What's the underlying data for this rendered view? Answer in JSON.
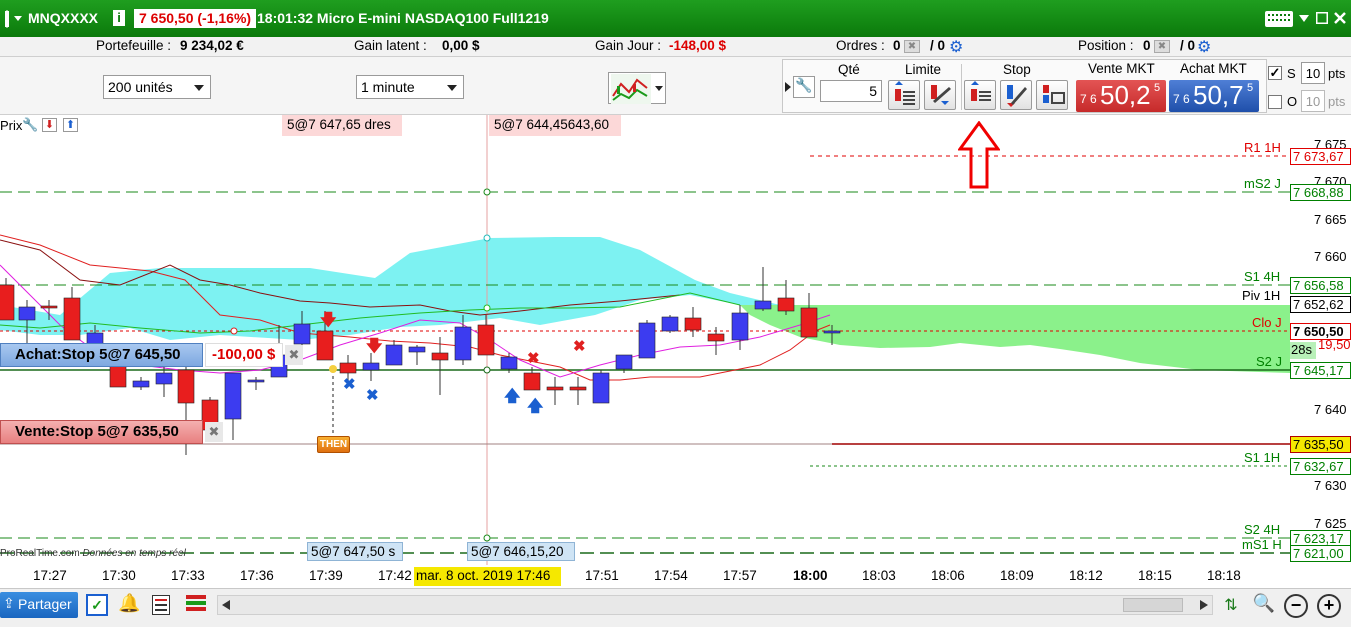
{
  "title": {
    "symbol": "MNQXXXX",
    "price_change": "7 650,50 (-1,16%)",
    "time_name": "18:01:32 Micro E-mini NASDAQ100 Full1219"
  },
  "info": {
    "portfolio_label": "Portefeuille :",
    "portfolio_value": "9 234,02 €",
    "latent_label": "Gain latent :",
    "latent_value": "0,00 $",
    "day_label": "Gain Jour :",
    "day_value": "-148,00 $",
    "orders_label": "Ordres :",
    "orders_count": "0",
    "orders_total": "/ 0",
    "position_label": "Position :",
    "position_count": "0",
    "position_total": "/ 0"
  },
  "toolbar": {
    "units": "200 unités",
    "interval": "1 minute"
  },
  "order_panel": {
    "qty_label": "Qté",
    "qty_value": "5",
    "limit_label": "Limite",
    "stop_label": "Stop",
    "sell_label": "Vente MKT",
    "sell_small": "7 6",
    "sell_big": "50,2",
    "sell_sup": "5",
    "buy_label": "Achat MKT",
    "buy_small": "7 6",
    "buy_big": "50,7",
    "buy_sup": "5",
    "s_label": "S",
    "s_value": "10",
    "o_label": "O",
    "o_value": "10",
    "pts": "pts"
  },
  "chart": {
    "prix_label": "Prix",
    "ann1": "5@7 647,65 ",
    "ann1b": "dres",
    "ann2": "5@7 644,45",
    "ann2b": "643,60",
    "ann3": "5@7 647,50 s",
    "ann4": "5@7 646,15",
    "ann4b": ",20",
    "buy_order": "Achat:Stop 5@7 645,50",
    "buy_pnl": "-100,00 $",
    "sell_order": "Vente:Stop 5@7 635,50",
    "then": "THEN",
    "credit": "ProRealTime.com ",
    "credit2": "Données en temps réel",
    "countdown": "28s"
  },
  "yaxis": {
    "ticks": [
      "7 675",
      "7 670",
      "7 665",
      "7 660",
      "7 640",
      "7 630",
      "7 625"
    ],
    "levels": [
      {
        "name": "R1 1H",
        "value": "7 673,67",
        "color": "#e00000"
      },
      {
        "name": "mS2 J",
        "value": "7 668,88",
        "color": "#008000"
      },
      {
        "name": "S1 4H",
        "value": "7 656,58",
        "color": "#008000"
      },
      {
        "name": "Piv 1H",
        "value": "7 652,62",
        "color": "#000000"
      },
      {
        "name": "Clo J",
        "value": "7 650,50",
        "color": "#e00000"
      },
      {
        "name": "S2 J",
        "value": "7 645,17",
        "color": "#008000"
      },
      {
        "name": "",
        "value": "7 635,50",
        "color": "#b00000"
      },
      {
        "name": "S1 1H",
        "value": "7 632,67",
        "color": "#008000"
      },
      {
        "name": "S2 4H",
        "value": "7 623,17",
        "color": "#008000"
      },
      {
        "name": "mS1 H",
        "value": "7 621,00",
        "color": "#008000"
      }
    ],
    "partial": "19,50"
  },
  "timeaxis": {
    "ticks": [
      "17:27",
      "17:30",
      "17:33",
      "17:36",
      "17:39",
      "17:42",
      "17:51",
      "17:54",
      "17:57",
      "18:00",
      "18:03",
      "18:06",
      "18:09",
      "18:12",
      "18:15",
      "18:18"
    ],
    "cursor_label": "mar. 8 oct. 2019 17:46"
  },
  "bottom": {
    "share": "Partager"
  }
}
